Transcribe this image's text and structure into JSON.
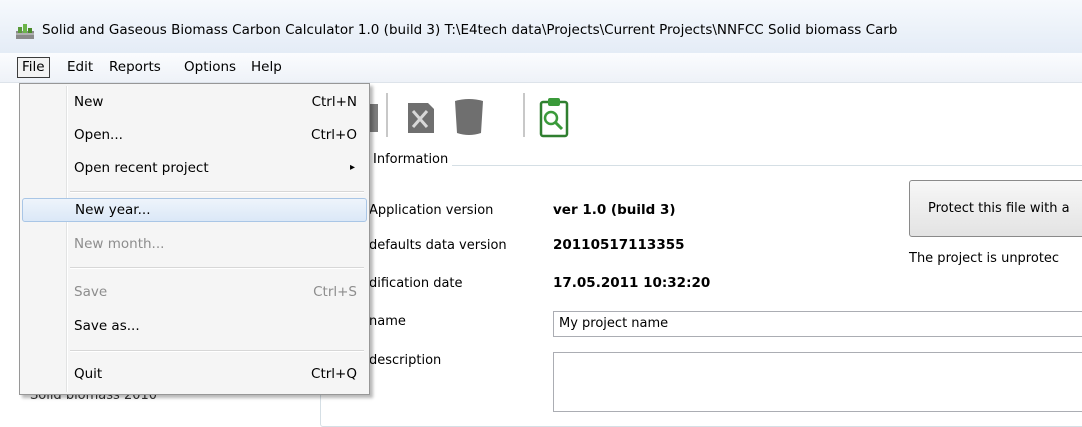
{
  "window": {
    "title": "Solid and Gaseous Biomass Carbon Calculator 1.0 (build 3) T:\\E4tech data\\Projects\\Current Projects\\NNFCC Solid biomass Carb"
  },
  "menubar": {
    "items": [
      {
        "label": "File"
      },
      {
        "label": "Edit"
      },
      {
        "label": "Reports"
      },
      {
        "label": "Options"
      },
      {
        "label": "Help"
      }
    ]
  },
  "file_menu": {
    "items": [
      {
        "label": "New",
        "shortcut": "Ctrl+N"
      },
      {
        "label": "Open...",
        "shortcut": "Ctrl+O"
      },
      {
        "label": "Open recent project",
        "submenu_arrow": "▸"
      },
      {
        "label": "New year..."
      },
      {
        "label": "New month..."
      },
      {
        "label": "Save",
        "shortcut": "Ctrl+S"
      },
      {
        "label": "Save as..."
      },
      {
        "label": "Quit",
        "shortcut": "Ctrl+Q"
      }
    ]
  },
  "info": {
    "group_title": "Information",
    "rows": [
      {
        "label": "Application version",
        "value": "ver 1.0 (build 3)"
      },
      {
        "label": "defaults data version",
        "value": "20110517113355"
      },
      {
        "label": "dification date",
        "value": "17.05.2011 10:32:20"
      },
      {
        "label": "name"
      },
      {
        "label": "description"
      }
    ],
    "protect_button": "Protect this file with a",
    "protect_status": "The project is unprotec",
    "name_value": "My project name"
  },
  "tree": {
    "partial_row": "Solid biomass 2010"
  },
  "colors": {
    "titlebar_bg": "#e4ecf6",
    "menu_highlight": "#dbe8f7",
    "disabled_text": "#8d8d8d",
    "icon_green": "#3a9a3a"
  },
  "icons": [
    "app-icon",
    "save-icon",
    "delete-icon",
    "trash-icon",
    "report-icon"
  ]
}
